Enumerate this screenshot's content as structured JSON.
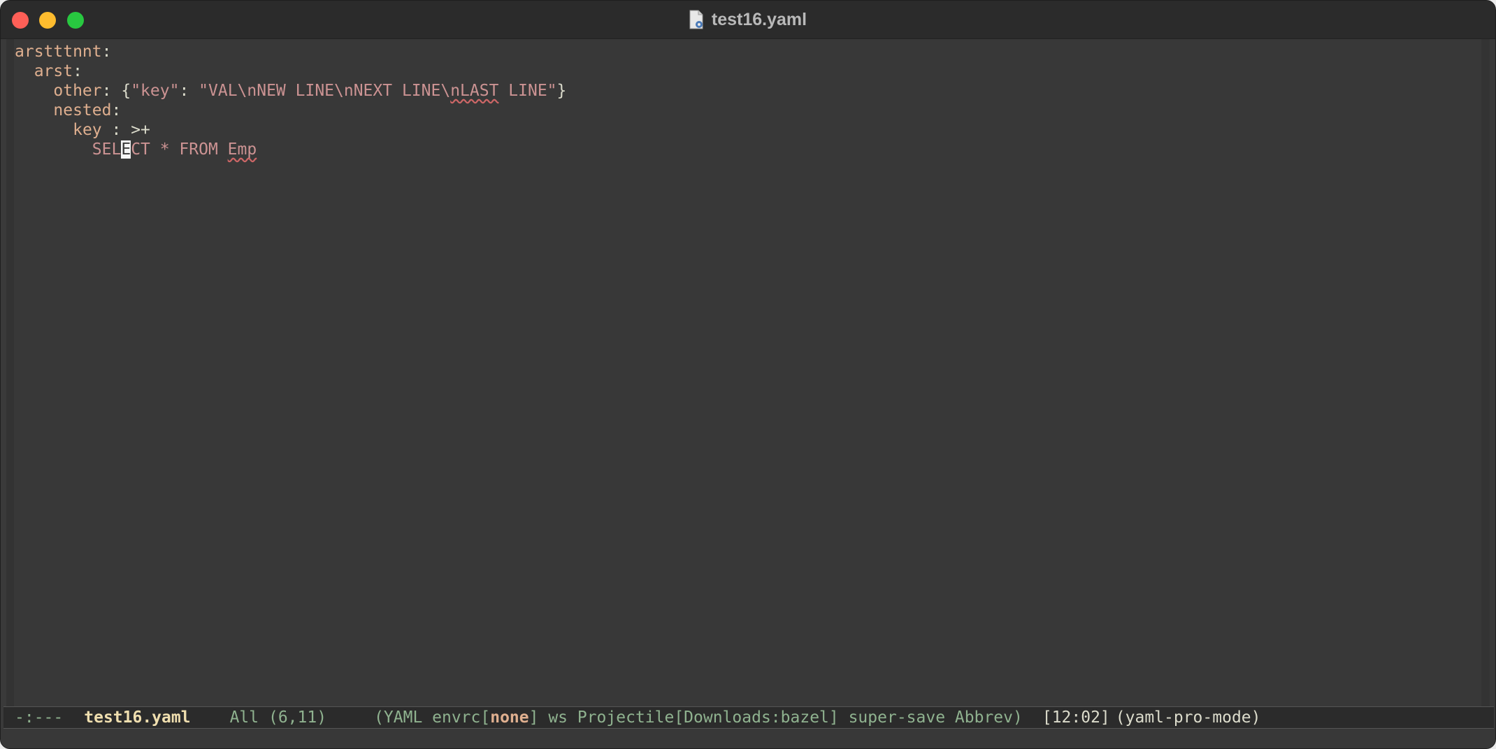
{
  "window": {
    "title": "test16.yaml",
    "icon": "yaml-file-icon"
  },
  "editor": {
    "lines": [
      {
        "indent": "",
        "key": "arstttnnt",
        "sep": ":"
      },
      {
        "indent": "  ",
        "key": "arst",
        "sep": ":"
      },
      {
        "indent": "    ",
        "key": "other",
        "sep": ": "
      },
      {
        "indent": "    ",
        "key": "nested",
        "sep": ":"
      },
      {
        "indent": "      ",
        "key": "key",
        "sep": " : ",
        "value": ">+"
      },
      {
        "indent": "        "
      }
    ],
    "flow": {
      "open": "{",
      "k": "\"key\"",
      "colon": ": ",
      "v_a": "\"VAL\\nNEW LINE\\nNEXT LINE\\",
      "v_b": "nLAST",
      "v_c": " LINE\"",
      "close": "}"
    },
    "sql": {
      "a": "SEL",
      "cursor_char": "E",
      "b": "CT * FROM ",
      "c": "Emp"
    },
    "cursor": {
      "line": 6,
      "column": 11
    }
  },
  "modeline": {
    "status": "-:---",
    "buffer": "test16.yaml",
    "position": "All (6,11)",
    "minor_modes_prefix": "(YAML envrc[",
    "envrc": "none",
    "minor_modes_suffix": "] ws Projectile[Downloads:bazel] super-save Abbrev)",
    "time": "[12:02]",
    "major_mode": "(yaml-pro-mode)"
  },
  "colors": {
    "background": "#383838",
    "key": "#dfaf8f",
    "string": "#cc9393",
    "modeline_text": "#8fb28f",
    "buffer_name": "#f0dfaf"
  }
}
